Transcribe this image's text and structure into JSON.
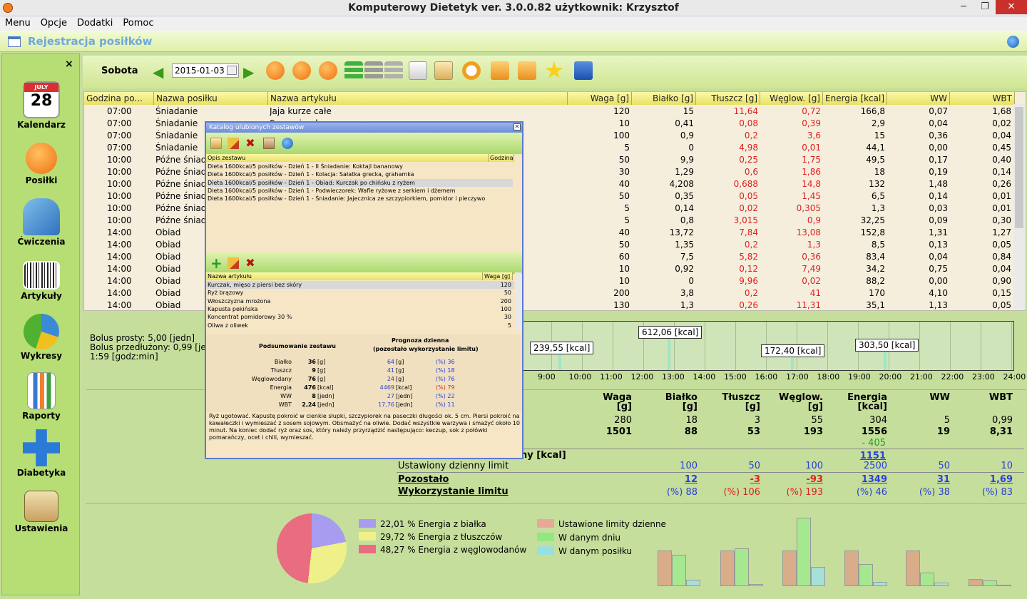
{
  "window": {
    "title": "Komputerowy Dietetyk  ver. 3.0.0.82 użytkownik: Krzysztof",
    "min": "─",
    "restore": "❐",
    "close": "✕"
  },
  "menu": [
    "Menu",
    "Opcje",
    "Dodatki",
    "Pomoc"
  ],
  "module": {
    "title": "Rejestracja posiłków"
  },
  "sidebar": {
    "close": "×",
    "items": [
      "Kalendarz",
      "Posiłki",
      "Ćwiczenia",
      "Artykuły",
      "Wykresy",
      "Raporty",
      "Diabetyka",
      "Ustawienia"
    ],
    "calendar_month": "JULY",
    "calendar_day": "28"
  },
  "toolbar": {
    "day": "Sobota",
    "date": "2015-01-03"
  },
  "grid": {
    "headers": [
      "Godzina po...",
      "Nazwa posiłku",
      "Nazwa artykułu",
      "Waga [g]",
      "Białko [g]",
      "Tłuszcz [g]",
      "Węglow. [g]",
      "Energia [kcal]",
      "WW",
      "WBT"
    ],
    "rows": [
      [
        "07:00",
        "Śniadanie",
        "Jaja kurze całe",
        "120",
        "15",
        "11,64",
        "0,72",
        "166,8",
        "0,07",
        "1,68"
      ],
      [
        "07:00",
        "Śniadanie",
        "Szczypiorek",
        "10",
        "0,41",
        "0,08",
        "0,39",
        "2,9",
        "0,04",
        "0,02"
      ],
      [
        "07:00",
        "Śniadanie",
        "",
        "100",
        "0,9",
        "0,2",
        "3,6",
        "15",
        "0,36",
        "0,04"
      ],
      [
        "07:00",
        "Śniadanie",
        "",
        "5",
        "0",
        "4,98",
        "0,01",
        "44,1",
        "0,00",
        "0,45"
      ],
      [
        "10:00",
        "Późne śniad",
        "",
        "50",
        "9,9",
        "0,25",
        "1,75",
        "49,5",
        "0,17",
        "0,40"
      ],
      [
        "10:00",
        "Późne śniad",
        "",
        "30",
        "1,29",
        "0,6",
        "1,86",
        "18",
        "0,19",
        "0,14"
      ],
      [
        "10:00",
        "Późne śniad",
        "",
        "40",
        "4,208",
        "0,688",
        "14,8",
        "132",
        "1,48",
        "0,26"
      ],
      [
        "10:00",
        "Późne śniad",
        "",
        "50",
        "0,35",
        "0,05",
        "1,45",
        "6,5",
        "0,14",
        "0,01"
      ],
      [
        "10:00",
        "Późne śniad",
        "",
        "5",
        "0,14",
        "0,02",
        "0,305",
        "1,3",
        "0,03",
        "0,01"
      ],
      [
        "10:00",
        "Późne śniad",
        "",
        "5",
        "0,8",
        "3,015",
        "0,9",
        "32,25",
        "0,09",
        "0,30"
      ],
      [
        "14:00",
        "Obiad",
        "",
        "40",
        "13,72",
        "7,84",
        "13,08",
        "152,8",
        "1,31",
        "1,27"
      ],
      [
        "14:00",
        "Obiad",
        "",
        "50",
        "1,35",
        "0,2",
        "1,3",
        "8,5",
        "0,13",
        "0,05"
      ],
      [
        "14:00",
        "Obiad",
        "",
        "60",
        "7,5",
        "5,82",
        "0,36",
        "83,4",
        "0,04",
        "0,84"
      ],
      [
        "14:00",
        "Obiad",
        "",
        "10",
        "0,92",
        "0,12",
        "7,49",
        "34,2",
        "0,75",
        "0,04"
      ],
      [
        "14:00",
        "Obiad",
        "",
        "10",
        "0",
        "9,96",
        "0,02",
        "88,2",
        "0,00",
        "0,90"
      ],
      [
        "14:00",
        "Obiad",
        "",
        "200",
        "3,8",
        "0,2",
        "41",
        "170",
        "4,10",
        "0,15"
      ],
      [
        "14:00",
        "Obiad",
        "",
        "130",
        "1,3",
        "0,26",
        "11,31",
        "35,1",
        "1,13",
        "0,05"
      ]
    ]
  },
  "bolus": {
    "line1": "Bolus prosty: 5,00 [jedn]",
    "line2": "Bolus przedłużony: 0,99 [jed",
    "line3": "1:59 [godz:min]"
  },
  "timeline": {
    "tags": [
      "239,55 [kcal]",
      "612,06 [kcal]",
      "172,40 [kcal]",
      "303,50 [kcal]"
    ],
    "hours": [
      "9:00",
      "10:00",
      "11:00",
      "12:00",
      "13:00",
      "14:00",
      "15:00",
      "16:00",
      "17:00",
      "18:00",
      "19:00",
      "20:00",
      "21:00",
      "22:00",
      "23:00",
      "24:00"
    ]
  },
  "summary": {
    "headers": [
      [
        "Waga",
        "[g]"
      ],
      [
        "Białko",
        "[g]"
      ],
      [
        "Tłuszcz",
        "[g]"
      ],
      [
        "Węglow.",
        "[g]"
      ],
      [
        "Energia",
        "[kcal]"
      ],
      [
        "WW",
        ""
      ],
      [
        "WBT",
        ""
      ]
    ],
    "meal_row": [
      "280",
      "18",
      "3",
      "55",
      "304",
      "5",
      "0,99"
    ],
    "day_row": [
      "1501",
      "88",
      "53",
      "193",
      "1556",
      "19",
      "8,31"
    ],
    "energy_diff": "- 405",
    "energy_label_partial": "ny [kcal]",
    "energy_value": "1151",
    "limit_label": "Ustawiony dzienny limit",
    "limit_row": [
      "100",
      "50",
      "100",
      "2500",
      "50",
      "10"
    ],
    "remaining_label": "Pozostało",
    "remaining_row": [
      "12",
      "-3",
      "-93",
      "1349",
      "31",
      "1,69"
    ],
    "usage_label": "Wykorzystanie limitu",
    "usage_row": [
      "(%) 88",
      "(%) 106",
      "(%) 193",
      "(%) 46",
      "(%) 38",
      "(%) 83"
    ]
  },
  "pie_legend": [
    "22,01 % Energia z białka",
    "29,72 % Energia z tłuszczów",
    "48,27 % Energia z węglowodanów"
  ],
  "pie_values": [
    22.01,
    29.72,
    48.27
  ],
  "bar_legend": [
    "Ustawione limity dzienne",
    "W danym dniu",
    "W danym posiłku"
  ],
  "colors": {
    "protein": "#a89cf0",
    "fat": "#f0f08a",
    "carb": "#ea6c80",
    "limit": "#d9ac8a",
    "day": "#a6e890",
    "meal": "#a6e0d8"
  },
  "dialog": {
    "title": "Katalog ulubionych zestawów",
    "sets_headers": [
      "Opis zestawu",
      "Godzina"
    ],
    "sets": [
      "Dieta 1600kcal/5 posiłków - Dzień 1 - II Śniadanie: Koktajl bananowy",
      "Dieta 1600kcal/5 posiłków - Dzień 1 - Kolacja: Sałatka grecka, grahamka",
      "Dieta 1600kcal/5 posiłków - Dzień 1 - Obiad: Kurczak po chińsku z ryżem",
      "Dieta 1600kcal/5 posiłków - Dzień 1 - Podwieczorek: Wafle ryżowe z serkiem i dżemem",
      "Dieta 1600kcal/5 posiłków - Dzień 1 - Śniadanie: Jajecznica ze szczypiorkiem, pomidor i pieczywo"
    ],
    "items_headers": [
      "Nazwa artykułu",
      "Waga [g]"
    ],
    "items": [
      [
        "Kurczak, mięso z piersi bez skóry",
        "120"
      ],
      [
        "Ryż brązowy",
        "50"
      ],
      [
        "Włoszczyzna mrożona",
        "200"
      ],
      [
        "Kapusta pekińska",
        "100"
      ],
      [
        "Koncentrat pomidorowy 30 %",
        "30"
      ],
      [
        "Oliwa z oliwek",
        "5"
      ]
    ],
    "summary_title": "Podsumowanie zestawu",
    "forecast_title": "Prognoza dzienna",
    "forecast_sub": "(pozostało   wykorzystanie limitu)",
    "nutrients": [
      [
        "Białko",
        "36",
        "[g]",
        "64",
        "[g]",
        "(%) 36"
      ],
      [
        "Tłuszcz",
        "9",
        "[g]",
        "41",
        "[g]",
        "(%) 18"
      ],
      [
        "Węglowodany",
        "76",
        "[g]",
        "24",
        "[g]",
        "(%) 76"
      ],
      [
        "Energia",
        "476",
        "[kcal]",
        "4469",
        "[kcal]",
        "(%) 79"
      ],
      [
        "WW",
        "8",
        "[jedn]",
        "27",
        "[jedn]",
        "(%) 22"
      ],
      [
        "WBT",
        "2,24",
        "[jedn]",
        "17,76",
        "[jedn]",
        "(%) 11"
      ]
    ],
    "recipe": "Ryż ugotować. Kapustę pokroić w cienkie słupki, szczypiorek na paseczki długości ok. 5 cm. Piersi pokroić na kawałeczki i wymieszać z sosem sojowym. Obsmażyć na oliwie. Dodać wszystkie warzywa i smażyć około 10 minut. Na koniec dodać ryż oraz sos, który należy przyrządzić następująco: keczup, sok z połówki pomarańczy, ocet i chili, wymieszać."
  }
}
